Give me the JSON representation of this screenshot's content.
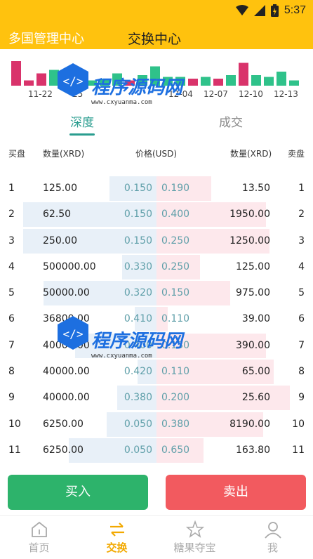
{
  "status": {
    "time": "5:37"
  },
  "header": {
    "manager_label": "多国管理中心",
    "title": "交换中心"
  },
  "chart_data": {
    "type": "bar",
    "x_tick_labels": [
      "11-22",
      "25",
      "12-04",
      "12-07",
      "12-10",
      "12-13"
    ],
    "bars": [
      {
        "value": 0.7,
        "color": "#d9336b"
      },
      {
        "value": 0.15,
        "color": "#d9336b"
      },
      {
        "value": 0.35,
        "color": "#d9336b"
      },
      {
        "value": 0.45,
        "color": "#2fc28a"
      },
      {
        "value": 0.25,
        "color": "#2fc28a"
      },
      {
        "value": 0.2,
        "color": "#d9336b"
      },
      {
        "value": 0.15,
        "color": "#2fc28a"
      },
      {
        "value": 0.2,
        "color": "#2fc28a"
      },
      {
        "value": 0.35,
        "color": "#2fc28a"
      },
      {
        "value": 0.15,
        "color": "#d9336b"
      },
      {
        "value": 0.3,
        "color": "#2fc28a"
      },
      {
        "value": 0.55,
        "color": "#2fc28a"
      },
      {
        "value": 0.25,
        "color": "#2fc28a"
      },
      {
        "value": 0.25,
        "color": "#2fc28a"
      },
      {
        "value": 0.2,
        "color": "#d9336b"
      },
      {
        "value": 0.25,
        "color": "#2fc28a"
      },
      {
        "value": 0.2,
        "color": "#d9336b"
      },
      {
        "value": 0.3,
        "color": "#2fc28a"
      },
      {
        "value": 0.65,
        "color": "#d9336b"
      },
      {
        "value": 0.3,
        "color": "#2fc28a"
      },
      {
        "value": 0.25,
        "color": "#2fc28a"
      },
      {
        "value": 0.4,
        "color": "#2fc28a"
      },
      {
        "value": 0.15,
        "color": "#2fc28a"
      }
    ]
  },
  "tabs": {
    "depth": "深度",
    "trades": "成交"
  },
  "columns": {
    "buy": "买盘",
    "buy_qty": "数量(XRD)",
    "price": "价格(USD)",
    "sell_qty": "数量(XRD)",
    "sell": "卖盘"
  },
  "orderbook": [
    {
      "idx": "1",
      "buy_qty": "125.00",
      "buy_price": "0.150",
      "sell_price": "0.190",
      "sell_qty": "13.50",
      "sell_idx": "1",
      "buy_depth": 0.3,
      "sell_depth": 0.35
    },
    {
      "idx": "2",
      "buy_qty": "62.50",
      "buy_price": "0.150",
      "sell_price": "0.400",
      "sell_qty": "1950.00",
      "sell_idx": "2",
      "buy_depth": 0.85,
      "sell_depth": 0.7
    },
    {
      "idx": "3",
      "buy_qty": "250.00",
      "buy_price": "0.150",
      "sell_price": "0.250",
      "sell_qty": "1250.00",
      "sell_idx": "3",
      "buy_depth": 0.85,
      "sell_depth": 0.72
    },
    {
      "idx": "4",
      "buy_qty": "500000.00",
      "buy_price": "0.330",
      "sell_price": "0.250",
      "sell_qty": "125.00",
      "sell_idx": "4",
      "buy_depth": 0.22,
      "sell_depth": 0.28
    },
    {
      "idx": "5",
      "buy_qty": "50000.00",
      "buy_price": "0.320",
      "sell_price": "0.150",
      "sell_qty": "975.00",
      "sell_idx": "5",
      "buy_depth": 0.72,
      "sell_depth": 0.47
    },
    {
      "idx": "6",
      "buy_qty": "36800.00",
      "buy_price": "0.410",
      "sell_price": "0.110",
      "sell_qty": "39.00",
      "sell_idx": "6",
      "buy_depth": 0.14,
      "sell_depth": 0.07
    },
    {
      "idx": "7",
      "buy_qty": "40000.00",
      "buy_price": "0.400",
      "sell_price": "0.130",
      "sell_qty": "390.00",
      "sell_idx": "7",
      "buy_depth": 0.52,
      "sell_depth": 0.7
    },
    {
      "idx": "8",
      "buy_qty": "40000.00",
      "buy_price": "0.420",
      "sell_price": "0.110",
      "sell_qty": "65.00",
      "sell_idx": "8",
      "buy_depth": 0.12,
      "sell_depth": 0.75
    },
    {
      "idx": "9",
      "buy_qty": "40000.00",
      "buy_price": "0.380",
      "sell_price": "0.200",
      "sell_qty": "25.60",
      "sell_idx": "9",
      "buy_depth": 0.25,
      "sell_depth": 0.85
    },
    {
      "idx": "10",
      "buy_qty": "6250.00",
      "buy_price": "0.050",
      "sell_price": "0.380",
      "sell_qty": "8190.00",
      "sell_idx": "10",
      "buy_depth": 0.32,
      "sell_depth": 0.68
    },
    {
      "idx": "11",
      "buy_qty": "6250.00",
      "buy_price": "0.050",
      "sell_price": "0.650",
      "sell_qty": "163.80",
      "sell_idx": "11",
      "buy_depth": 0.56,
      "sell_depth": 0.3
    }
  ],
  "actions": {
    "buy": "买入",
    "sell": "卖出"
  },
  "nav": [
    {
      "label": "首页",
      "icon": "home-icon",
      "active": false
    },
    {
      "label": "交换",
      "icon": "exchange-icon",
      "active": true
    },
    {
      "label": "糖果夺宝",
      "icon": "star-icon",
      "active": false
    },
    {
      "label": "我",
      "icon": "user-icon",
      "active": false
    }
  ],
  "watermark": {
    "text": "程序源码网",
    "url": "www.cxyuanma.com"
  },
  "colors": {
    "accent": "#ffc20e",
    "teal": "#2a9d8f",
    "buy": "#2db36b",
    "sell": "#f25a5f"
  }
}
